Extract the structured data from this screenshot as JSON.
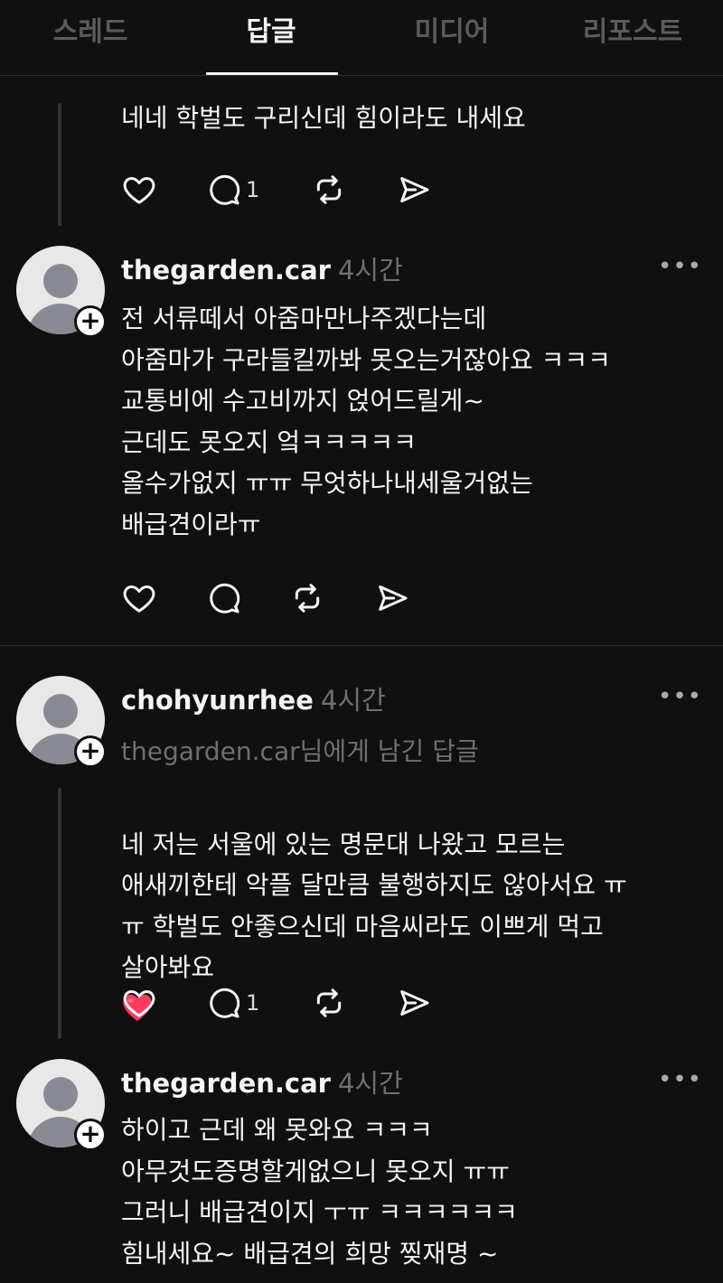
{
  "tabs": [
    {
      "label": "스레드"
    },
    {
      "label": "답글"
    },
    {
      "label": "미디어"
    },
    {
      "label": "리포스트"
    }
  ],
  "posts": [
    {
      "text": "네네 학벌도 구리신데 힘이라도 내세요",
      "reply_count": "1"
    },
    {
      "username": "thegarden.car",
      "time": "4시간",
      "text": "전 서류떼서 아줌마만나주겠다는데\n아줌마가 구라들킬까봐 못오는거잖아요 ㅋㅋㅋ\n교통비에 수고비까지 얹어드릴게~\n근데도 못오지 엌ㅋㅋㅋㅋㅋ\n올수가없지 ㅠㅠ 무엇하나내세울거없는\n배급견이라ㅠ"
    },
    {
      "username": "chohyunrhee",
      "time": "4시간",
      "reply_to": "thegarden.car님에게 남긴 답글",
      "text": "네 저는 서울에 있는 명문대 나왔고 모르는\n애새끼한테 악플 달만큼 불행하지도 않아서요 ㅠ\nㅠ 학벌도 안좋으신데 마음씨라도 이쁘게 먹고\n살아봐요",
      "emoji": "red-heart",
      "reply_count": "1"
    },
    {
      "username": "thegarden.car",
      "time": "4시간",
      "text": "하이고 근데 왜 못와요 ㅋㅋㅋ\n아무것도증명할게없으니 못오지 ㅠㅠ\n그러니 배급견이지 ㅜㅠ ㅋㅋㅋㅋㅋㅋ\n힘내세요~ 배급견의 희망 찢재명 ~"
    }
  ],
  "more_label": "•••",
  "plus_label": "+",
  "colors": {
    "background": "#101010",
    "text": "#f3f5f7",
    "muted": "#6f6f6f",
    "heart": "#ff3b5c"
  }
}
